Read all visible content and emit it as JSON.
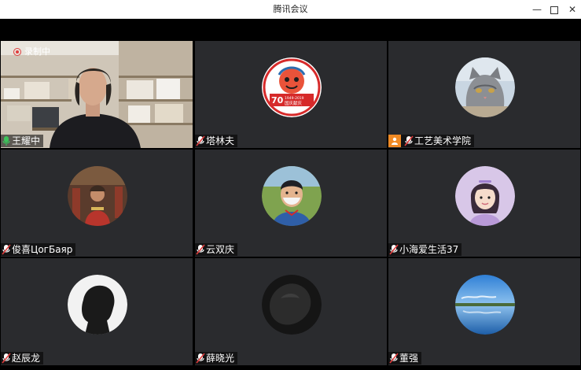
{
  "window": {
    "title": "腾讯会议",
    "min_glyph": "—",
    "close_glyph": "✕"
  },
  "recording": {
    "label": "录制中"
  },
  "participants": [
    {
      "name": "王耀中",
      "mic": "active",
      "video": true
    },
    {
      "name": "塔林夫",
      "mic": "muted"
    },
    {
      "name": "工艺美术学院",
      "mic": "muted",
      "host": true
    },
    {
      "name": "俊喜ЦогБаяр",
      "mic": "muted"
    },
    {
      "name": "云双庆",
      "mic": "muted"
    },
    {
      "name": "小海爱生活37",
      "mic": "muted"
    },
    {
      "name": "赵辰龙",
      "mic": "muted"
    },
    {
      "name": "薛晓光",
      "mic": "muted"
    },
    {
      "name": "董强",
      "mic": "muted"
    }
  ],
  "logo_badge": {
    "number": "70",
    "years": "1949-2019",
    "caption": "国庆献庆"
  },
  "colors": {
    "tile_bg": "#2a2b2e",
    "active_border": "#2fb26a",
    "host_badge": "#f08a24",
    "mic_muted": "#e03c3c",
    "mic_active": "#3cc35a"
  }
}
